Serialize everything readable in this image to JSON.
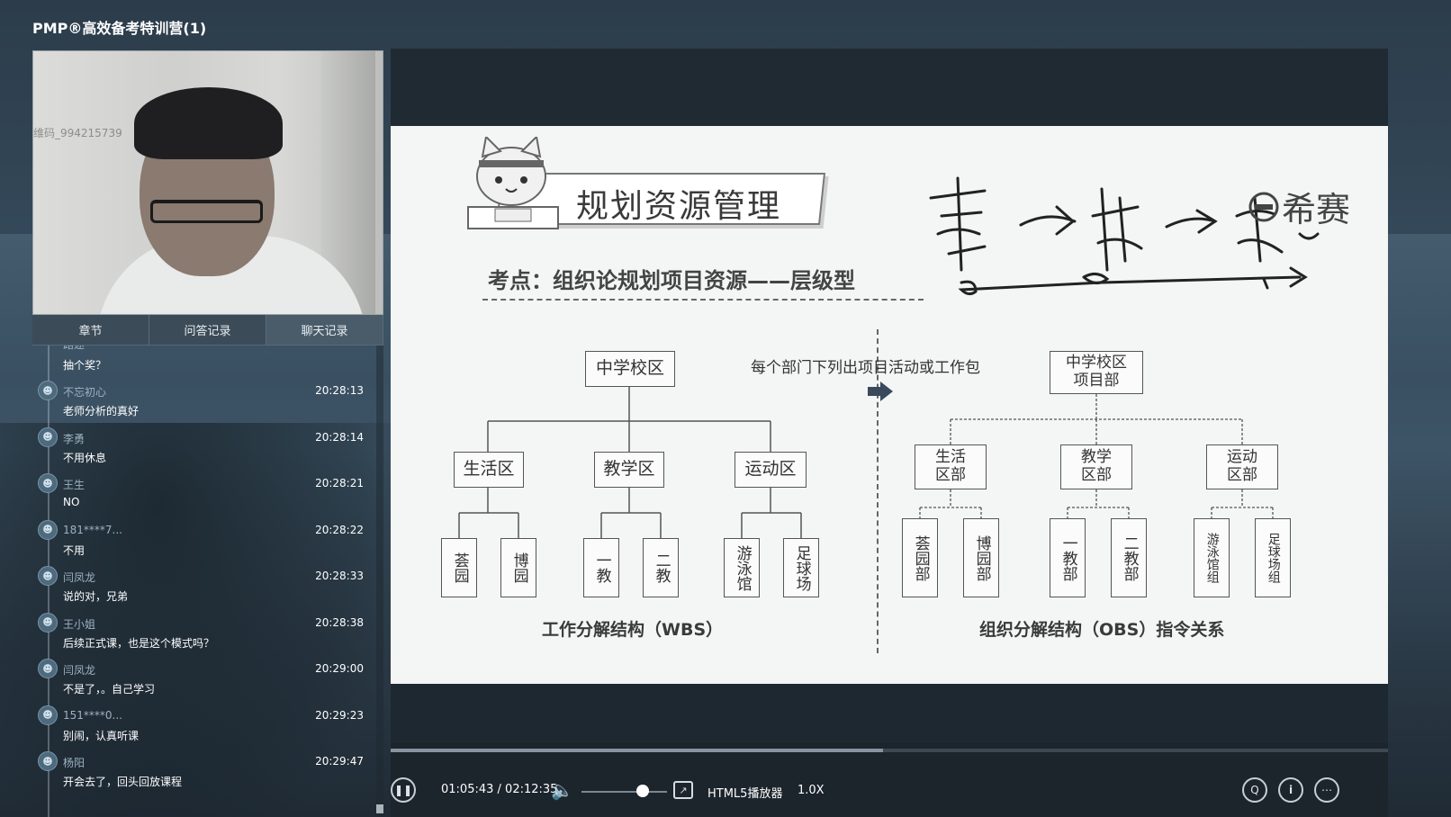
{
  "app": {
    "title": "PMP®高效备考特训营(1)"
  },
  "webcam": {
    "watermark": "维码_994215739"
  },
  "tabs": [
    {
      "label": "章节"
    },
    {
      "label": "问答记录"
    },
    {
      "label": "聊天记录"
    }
  ],
  "chat": {
    "top_name": "路途",
    "top_text": "抽个奖？",
    "messages": [
      {
        "name": "不忘初心",
        "time": "20:28:13",
        "text": "老师分析的真好"
      },
      {
        "name": "李勇",
        "time": "20:28:14",
        "text": "不用休息"
      },
      {
        "name": "王生",
        "time": "20:28:21",
        "text": "NO"
      },
      {
        "name": "181****7...",
        "time": "20:28:22",
        "text": "不用"
      },
      {
        "name": "闫凤龙",
        "time": "20:28:33",
        "text": "说的对，兄弟"
      },
      {
        "name": "王小姐",
        "time": "20:28:38",
        "text": "后续正式课，也是这个模式吗？"
      },
      {
        "name": "闫凤龙",
        "time": "20:29:00",
        "text": "不是了，。自己学习"
      },
      {
        "name": "151****0...",
        "time": "20:29:23",
        "text": "别闹，认真听课"
      },
      {
        "name": "杨阳",
        "time": "20:29:47",
        "text": "开会去了，回头回放课程"
      }
    ]
  },
  "slide": {
    "banner": "规划资源管理",
    "subtitle": "考点：组织论规划项目资源——层级型",
    "note": "每个部门下列出项目活动或工作包",
    "wbs": {
      "root": "中学校区",
      "children": [
        "生活区",
        "教学区",
        "运动区"
      ],
      "leaves": [
        "荟园",
        "博园",
        "一教",
        "二教",
        "游泳馆",
        "足球场"
      ],
      "caption": "工作分解结构（WBS）"
    },
    "obs": {
      "root": "中学校区项目部",
      "children": [
        "生活区部",
        "教学区部",
        "运动区部"
      ],
      "leaves": [
        "荟园部",
        "博园部",
        "一教部",
        "二教部",
        "游泳馆组",
        "足球场组"
      ],
      "caption": "组织分解结构（OBS）指令关系"
    },
    "logo_text": "希赛"
  },
  "player": {
    "current_time": "01:05:43",
    "duration": "02:12:35",
    "time_sep": " / ",
    "progress": 0.494,
    "volume": 0.72,
    "player_label": "HTML5播放器",
    "speed": "1.0X"
  },
  "icons": {
    "pause": "pause-icon",
    "volume": "volume-icon",
    "fullscreen": "screen-icon",
    "qa": "qa-icon",
    "info": "info-icon",
    "more": "more-icon"
  }
}
